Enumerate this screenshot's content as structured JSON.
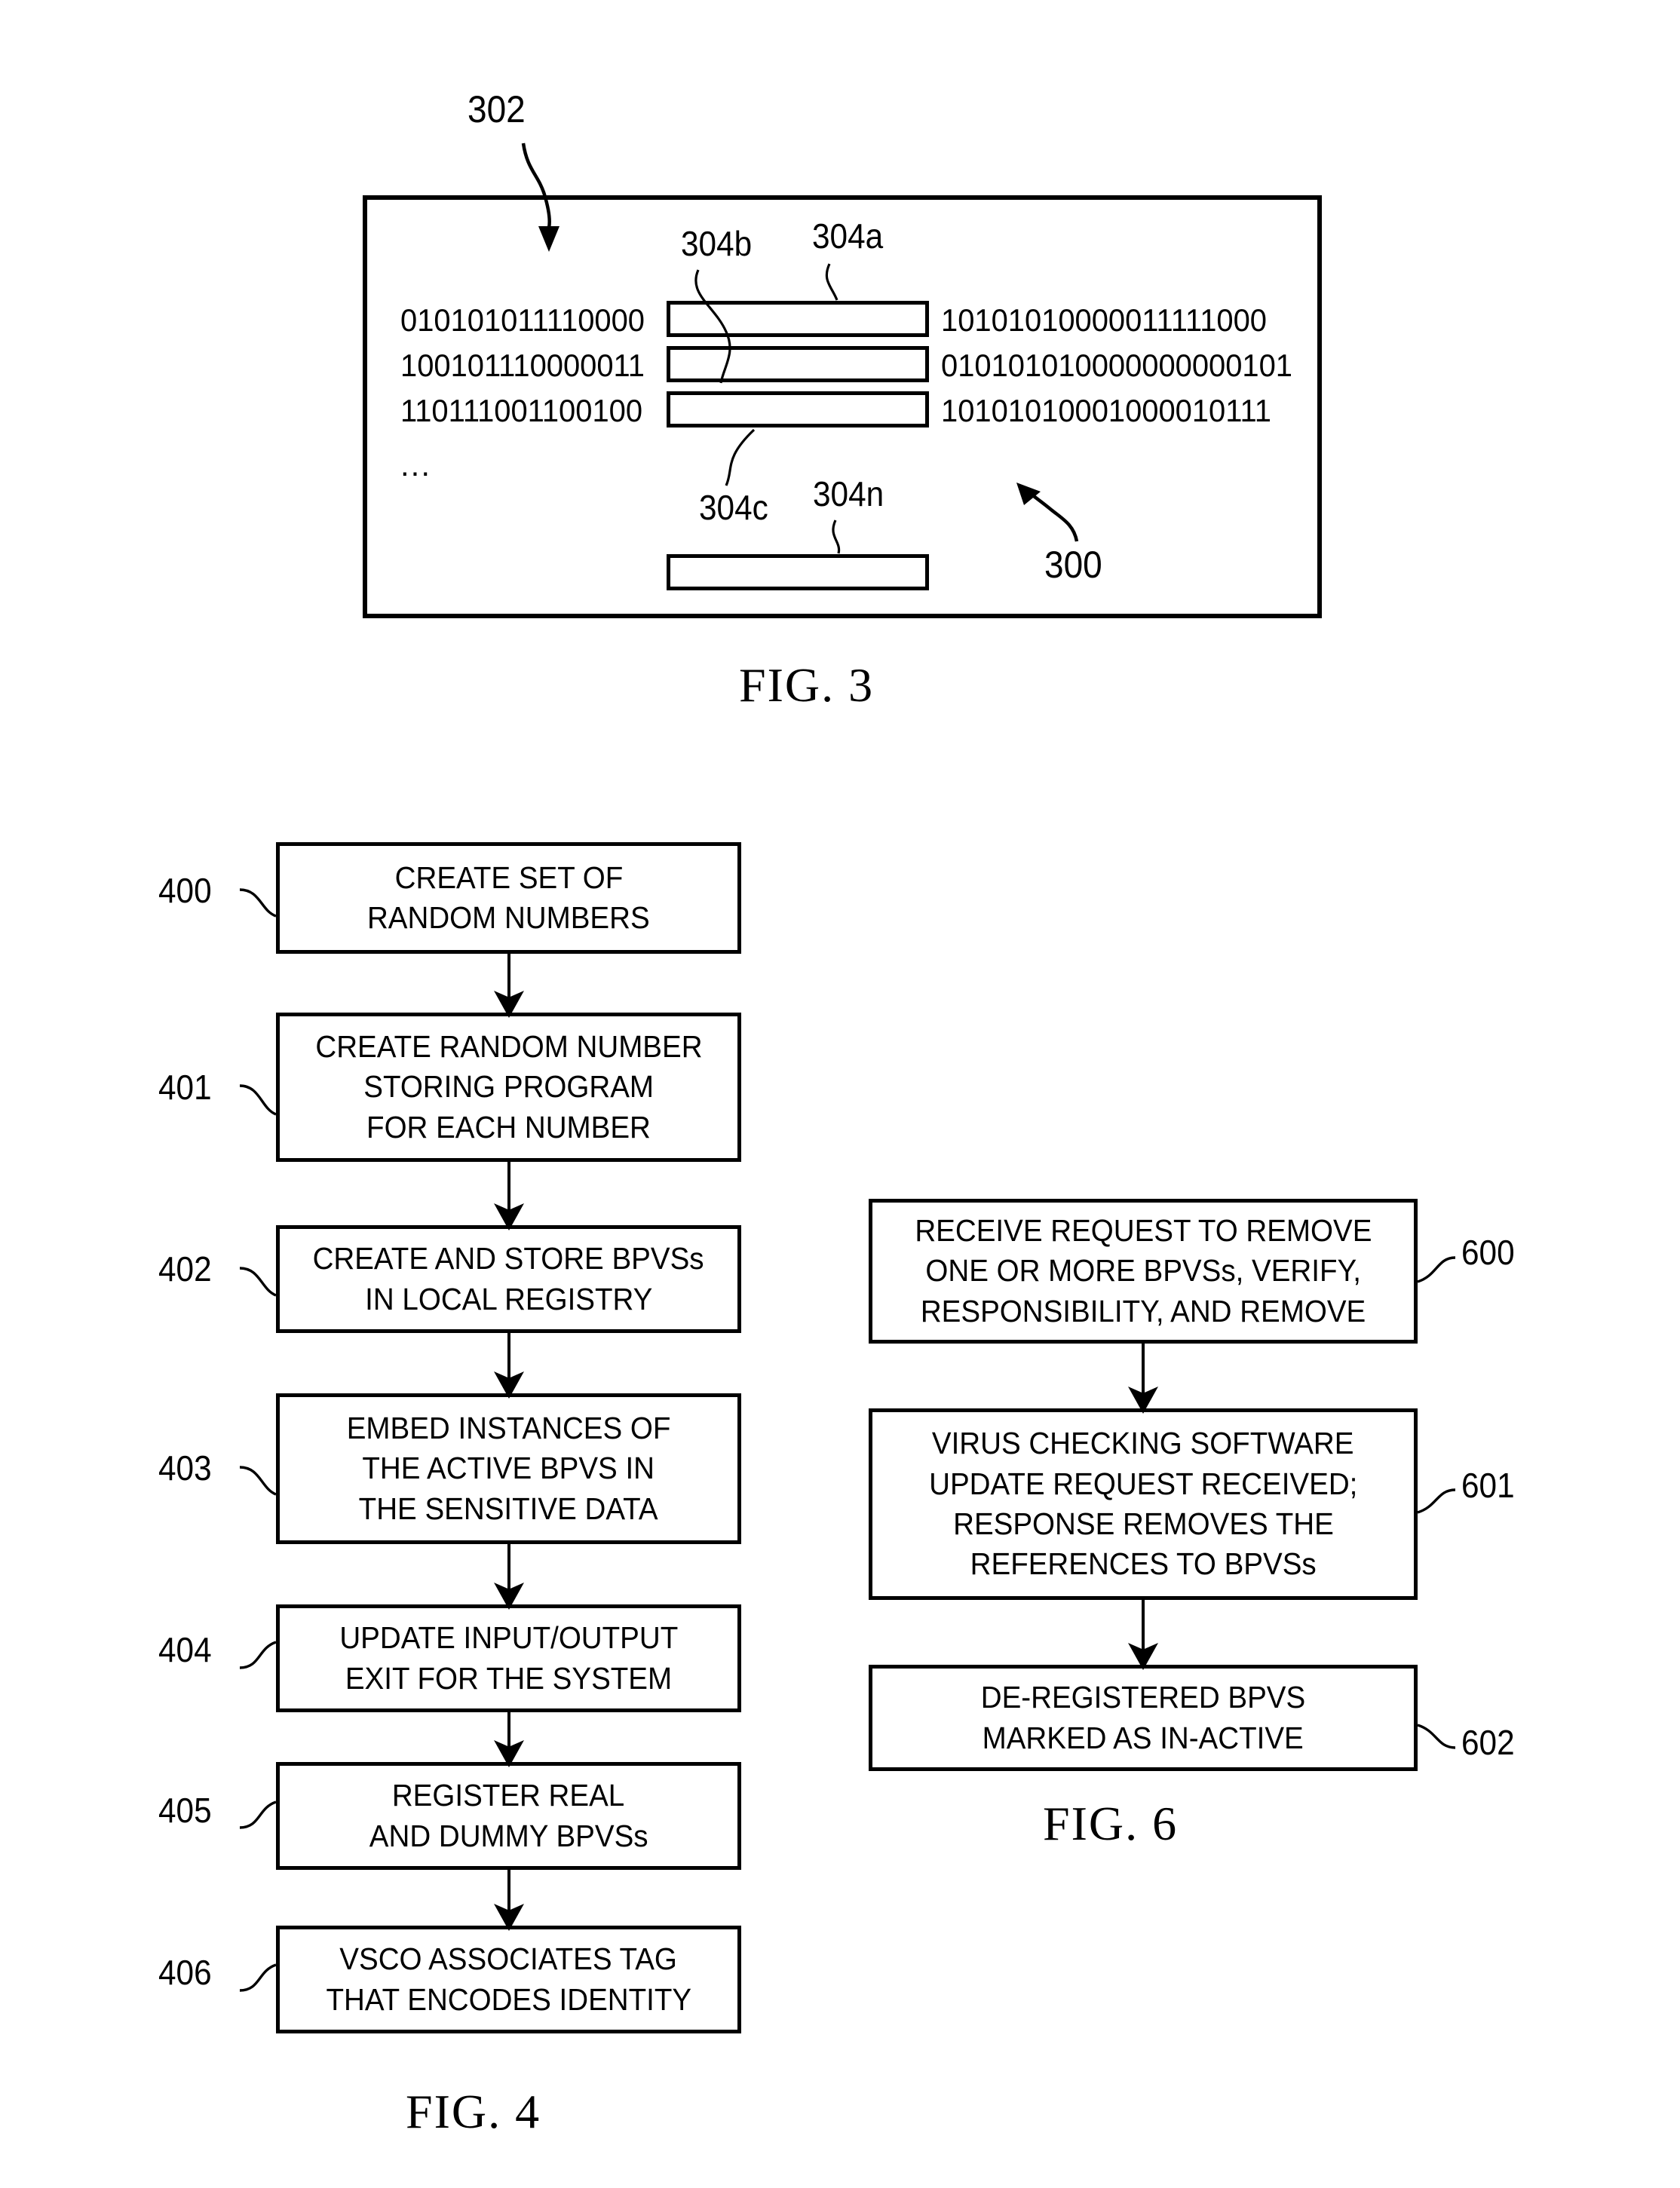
{
  "figures": {
    "fig3": {
      "caption": "FIG. 3",
      "container_ref": "302",
      "system_ref": "300",
      "binary_left": [
        "010101011110000",
        "100101110000011",
        "110111001100100"
      ],
      "binary_right": [
        "10101010000011111000",
        "010101010000000000101",
        "10101010001000010111"
      ],
      "ellipsis": "...",
      "slot_refs": {
        "a": "304a",
        "b": "304b",
        "c": "304c",
        "n": "304n"
      }
    },
    "fig4": {
      "caption": "FIG. 4",
      "steps": [
        {
          "ref": "400",
          "lines": [
            "CREATE SET OF",
            "RANDOM NUMBERS"
          ]
        },
        {
          "ref": "401",
          "lines": [
            "CREATE RANDOM NUMBER",
            "STORING PROGRAM",
            "FOR EACH NUMBER"
          ]
        },
        {
          "ref": "402",
          "lines": [
            "CREATE AND STORE BPVSs",
            "IN LOCAL REGISTRY"
          ]
        },
        {
          "ref": "403",
          "lines": [
            "EMBED INSTANCES OF",
            "THE ACTIVE BPVS IN",
            "THE SENSITIVE DATA"
          ]
        },
        {
          "ref": "404",
          "lines": [
            "UPDATE INPUT/OUTPUT",
            "EXIT FOR THE SYSTEM"
          ]
        },
        {
          "ref": "405",
          "lines": [
            "REGISTER REAL",
            "AND DUMMY BPVSs"
          ]
        },
        {
          "ref": "406",
          "lines": [
            "VSCO ASSOCIATES TAG",
            "THAT ENCODES IDENTITY"
          ]
        }
      ]
    },
    "fig6": {
      "caption": "FIG. 6",
      "steps": [
        {
          "ref": "600",
          "lines": [
            "RECEIVE REQUEST TO REMOVE",
            "ONE OR MORE BPVSs, VERIFY,",
            "RESPONSIBILITY, AND REMOVE"
          ]
        },
        {
          "ref": "601",
          "lines": [
            "VIRUS CHECKING SOFTWARE",
            "UPDATE REQUEST RECEIVED;",
            "RESPONSE REMOVES THE",
            "REFERENCES TO BPVSs"
          ]
        },
        {
          "ref": "602",
          "lines": [
            "DE-REGISTERED BPVS",
            "MARKED AS IN-ACTIVE"
          ]
        }
      ]
    }
  },
  "colors": {
    "ink": "#000000",
    "paper": "#ffffff"
  }
}
